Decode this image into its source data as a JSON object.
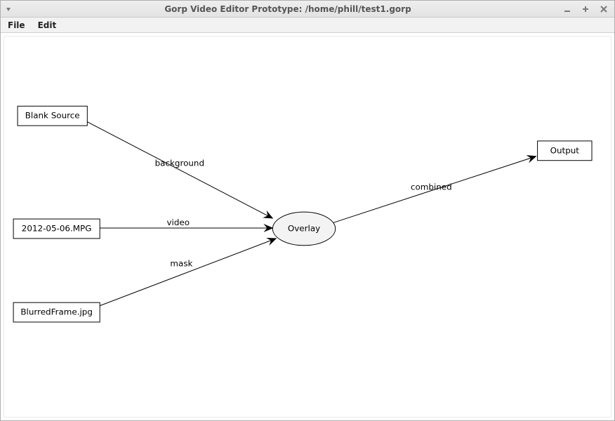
{
  "window": {
    "title": "Gorp Video Editor Prototype: /home/phill/test1.gorp"
  },
  "menubar": {
    "file": "File",
    "edit": "Edit"
  },
  "graph": {
    "nodes": {
      "blank_source": {
        "label": "Blank Source"
      },
      "mpg_source": {
        "label": "2012-05-06.MPG"
      },
      "blurred": {
        "label": "BlurredFrame.jpg"
      },
      "overlay": {
        "label": "Overlay"
      },
      "output": {
        "label": "Output"
      }
    },
    "edges": {
      "bg": {
        "label": "background"
      },
      "video": {
        "label": "video"
      },
      "mask": {
        "label": "mask"
      },
      "combined": {
        "label": "combined"
      }
    }
  }
}
